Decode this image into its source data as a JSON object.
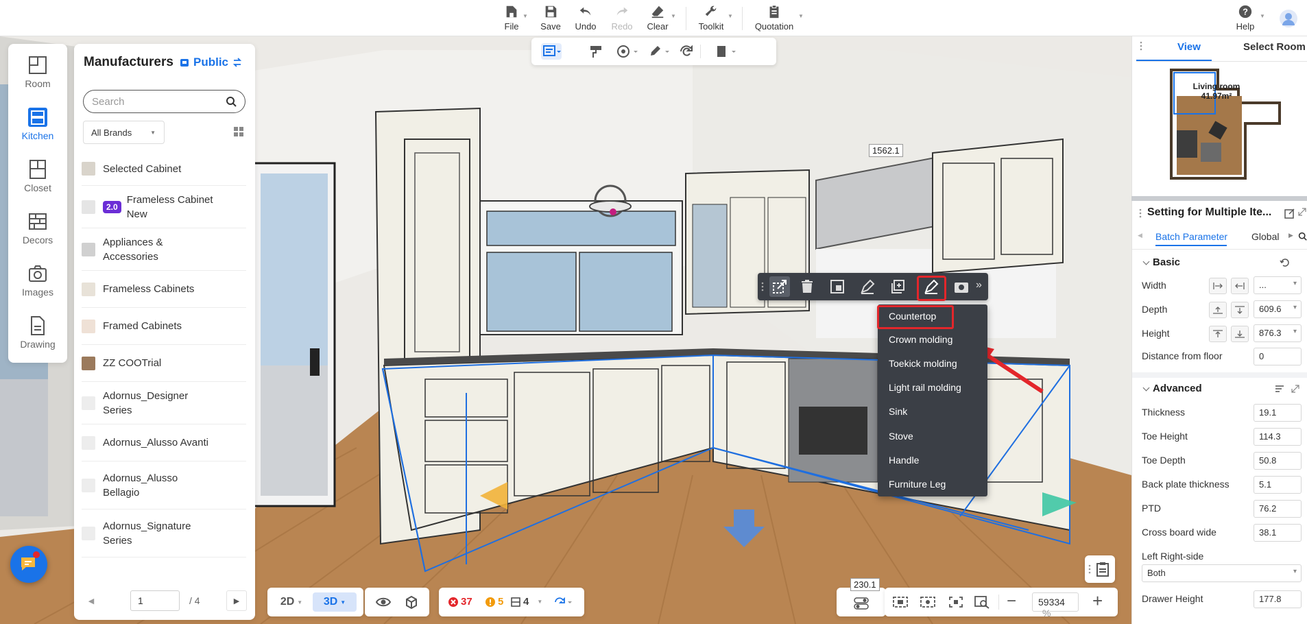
{
  "toolbar": {
    "file": "File",
    "save": "Save",
    "undo": "Undo",
    "redo": "Redo",
    "clear": "Clear",
    "toolkit": "Toolkit",
    "quotation": "Quotation",
    "help": "Help"
  },
  "leftnav": {
    "items": [
      {
        "label": "Room",
        "icon": "room-icon"
      },
      {
        "label": "Kitchen",
        "icon": "kitchen-icon"
      },
      {
        "label": "Closet",
        "icon": "closet-icon"
      },
      {
        "label": "Decors",
        "icon": "decors-icon"
      },
      {
        "label": "Images",
        "icon": "camera-icon"
      },
      {
        "label": "Drawing",
        "icon": "drawing-icon"
      }
    ]
  },
  "manufacturers": {
    "title": "Manufacturers",
    "scope": "Public",
    "search_placeholder": "Search",
    "brand_filter": "All Brands",
    "items": [
      {
        "name": "Selected Cabinet",
        "badge": ""
      },
      {
        "name": "Frameless Cabinet New",
        "badge": "2.0"
      },
      {
        "name": "Appliances & Accessories",
        "badge": ""
      },
      {
        "name": "Frameless Cabinets",
        "badge": ""
      },
      {
        "name": "Framed Cabinets",
        "badge": ""
      },
      {
        "name": "ZZ COOTrial",
        "badge": ""
      },
      {
        "name": "Adornus_Designer Series",
        "badge": ""
      },
      {
        "name": "Adornus_Alusso Avanti",
        "badge": ""
      },
      {
        "name": "Adornus_Alusso Bellagio",
        "badge": ""
      },
      {
        "name": "Adornus_Signature Series",
        "badge": ""
      }
    ],
    "page": "1",
    "page_total": "/ 4"
  },
  "viewport": {
    "dimension_top": "1562.1",
    "dimension_bottom": "230.1"
  },
  "context_menu": {
    "items": [
      "Countertop",
      "Crown molding",
      "Toekick molding",
      "Light rail molding",
      "Sink",
      "Stove",
      "Handle",
      "Furniture Leg"
    ],
    "highlighted": "Countertop"
  },
  "minimap": {
    "tab_view": "View",
    "tab_select": "Select Room",
    "room_name": "Living room",
    "room_area": "41.97m²"
  },
  "settings": {
    "title": "Setting for Multiple Ite...",
    "tab_batch": "Batch Parameter",
    "tab_global": "Global",
    "basic_title": "Basic",
    "advanced_title": "Advanced",
    "basic": [
      {
        "label": "Width",
        "value": "..."
      },
      {
        "label": "Depth",
        "value": "609.6"
      },
      {
        "label": "Height",
        "value": "876.3"
      },
      {
        "label": "Distance from floor",
        "value": "0"
      }
    ],
    "advanced": [
      {
        "label": "Thickness",
        "value": "19.1"
      },
      {
        "label": "Toe Height",
        "value": "114.3"
      },
      {
        "label": "Toe Depth",
        "value": "50.8"
      },
      {
        "label": "Back plate thickness",
        "value": "5.1"
      },
      {
        "label": "PTD",
        "value": "76.2"
      },
      {
        "label": "Cross board wide",
        "value": "38.1"
      }
    ],
    "left_right_label": "Left Right-side",
    "left_right_value": "Both",
    "drawer_height_label": "Drawer Height",
    "drawer_height_value": "177.8"
  },
  "bottom": {
    "mode_2d": "2D",
    "mode_3d": "3D",
    "errors": "37",
    "warnings": "5",
    "items": "4",
    "zoom_value": "59334",
    "zoom_unit": "%"
  },
  "colors": {
    "accent": "#1a73e8",
    "highlight": "#e3262b",
    "menu_bg": "#3b3f46",
    "badge": "#6b2ed6"
  }
}
